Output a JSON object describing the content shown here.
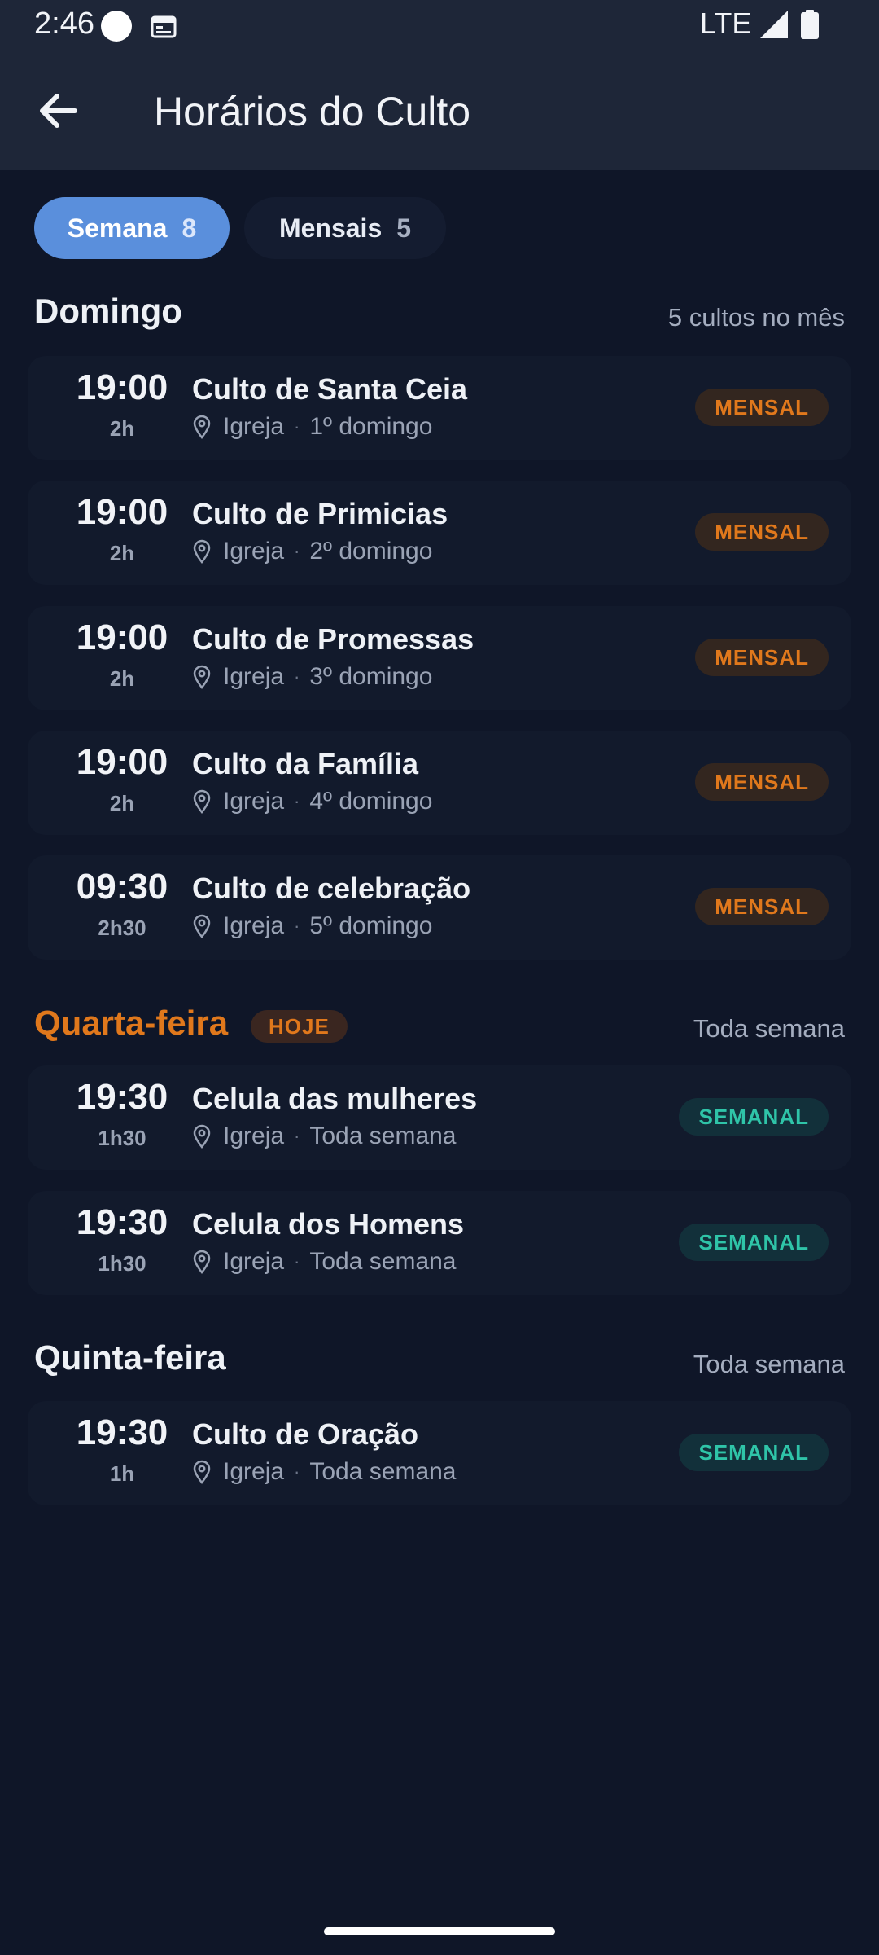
{
  "status_bar": {
    "time": "2:46",
    "network": "LTE"
  },
  "app_bar": {
    "title": "Horários do Culto",
    "back_icon": "arrow-left-icon"
  },
  "tabs": [
    {
      "label": "Semana",
      "count": "8",
      "selected": true
    },
    {
      "label": "Mensais",
      "count": "5",
      "selected": false
    }
  ],
  "sections": [
    {
      "title": "Domingo",
      "meta": "5 cultos no mês",
      "services": [
        {
          "time": "19:00",
          "duration": "2h",
          "name": "Culto de Santa Ceia",
          "place": "Igreja",
          "recurrence": "1º domingo",
          "badge": "MENSAL"
        },
        {
          "time": "19:00",
          "duration": "2h",
          "name": "Culto de Primicias",
          "place": "Igreja",
          "recurrence": "2º domingo",
          "badge": "MENSAL"
        },
        {
          "time": "19:00",
          "duration": "2h",
          "name": "Culto de Promessas",
          "place": "Igreja",
          "recurrence": "3º domingo",
          "badge": "MENSAL"
        },
        {
          "time": "19:00",
          "duration": "2h",
          "name": "Culto da Família",
          "place": "Igreja",
          "recurrence": "4º domingo",
          "badge": "MENSAL"
        },
        {
          "time": "09:30",
          "duration": "2h30",
          "name": "Culto de celebração",
          "place": "Igreja",
          "recurrence": "5º domingo",
          "badge": "MENSAL"
        }
      ]
    },
    {
      "title": "Quarta-feira",
      "today_badge": "HOJE",
      "meta": "Toda semana",
      "services": [
        {
          "time": "19:30",
          "duration": "1h30",
          "name": "Celula das mulheres",
          "place": "Igreja",
          "recurrence": "Toda semana",
          "badge": "SEMANAL"
        },
        {
          "time": "19:30",
          "duration": "1h30",
          "name": "Celula dos Homens",
          "place": "Igreja",
          "recurrence": "Toda semana",
          "badge": "SEMANAL"
        }
      ]
    },
    {
      "title": "Quinta-feira",
      "meta": "Toda semana",
      "services": [
        {
          "time": "19:30",
          "duration": "1h",
          "name": "Culto de Oração",
          "place": "Igreja",
          "recurrence": "Toda semana",
          "badge": "SEMANAL"
        }
      ]
    }
  ],
  "colors": {
    "background": "#0f1628",
    "accent_blue": "#5a8fdc",
    "monthly_orange": "#e0781c",
    "weekly_teal": "#2fc4a8"
  }
}
